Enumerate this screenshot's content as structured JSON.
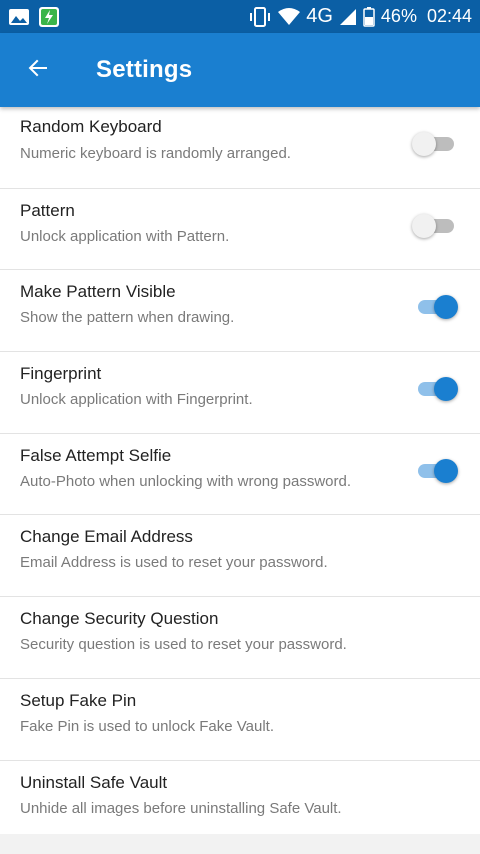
{
  "status_bar": {
    "network": "4G",
    "battery": "46%",
    "time": "02:44"
  },
  "header": {
    "title": "Settings"
  },
  "settings": [
    {
      "title": "Random Keyboard",
      "subtitle": "Numeric keyboard is randomly arranged.",
      "toggle": false
    },
    {
      "title": "Pattern",
      "subtitle": "Unlock application with Pattern.",
      "toggle": false
    },
    {
      "title": "Make Pattern Visible",
      "subtitle": "Show the pattern when drawing.",
      "toggle": true
    },
    {
      "title": "Fingerprint",
      "subtitle": "Unlock application with Fingerprint.",
      "toggle": true
    },
    {
      "title": "False Attempt Selfie",
      "subtitle": "Auto-Photo when unlocking with wrong password.",
      "toggle": true
    },
    {
      "title": "Change Email Address",
      "subtitle": "Email Address is used to reset your password."
    },
    {
      "title": "Change Security Question",
      "subtitle": "Security question is used to reset your password."
    },
    {
      "title": "Setup Fake Pin",
      "subtitle": "Fake Pin is used to unlock Fake Vault."
    },
    {
      "title": "Uninstall Safe Vault",
      "subtitle": "Unhide all images before uninstalling Safe Vault."
    }
  ],
  "colors": {
    "status_bar": "#0b5fa5",
    "app_bar": "#1a7fd0",
    "toggle_on": "#1a7fd0",
    "toggle_off": "#bdbdbd"
  }
}
